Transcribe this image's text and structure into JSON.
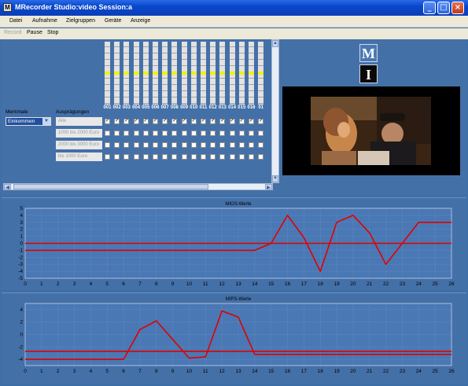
{
  "window": {
    "title": "MRecorder Studio:video Session:a",
    "app_icon": "M"
  },
  "menu": [
    "Datei",
    "Aufnahme",
    "Zielgruppen",
    "Geräte",
    "Anzeige"
  ],
  "toolbar": {
    "record": "Record",
    "pause": "Pause",
    "stop": "Stop"
  },
  "panel": {
    "merkmale_label": "Merkmale",
    "auspraegungen_label": "Ausprägungen",
    "merkmal_selected": "Einkommen",
    "auspraegungen": [
      "Alle",
      "1000 bis 2000 Euro",
      "2000 bis 3000 Euro",
      "bis 1000 Euro"
    ],
    "columns": [
      "001",
      "002",
      "003",
      "004",
      "005",
      "006",
      "007",
      "008",
      "009",
      "010",
      "011",
      "012",
      "013",
      "014",
      "015",
      "016",
      "01"
    ],
    "meter_level_fraction": 0.5,
    "colors": {
      "meter_level": "#f2f200",
      "panel_bg": "#4470a8"
    }
  },
  "logo": {
    "top": "M",
    "bottom": "I"
  },
  "chart_data": [
    {
      "type": "line",
      "title": "MIOS-Werte",
      "xlabel": "",
      "ylabel": "",
      "xlim": [
        0,
        26
      ],
      "ylim": [
        -5,
        5
      ],
      "xticks": [
        0,
        1,
        2,
        3,
        4,
        5,
        6,
        7,
        8,
        9,
        10,
        11,
        12,
        13,
        14,
        15,
        16,
        17,
        18,
        19,
        20,
        21,
        22,
        23,
        24,
        25,
        26
      ],
      "yticks": [
        5,
        4,
        3,
        2,
        1,
        0,
        -1,
        -2,
        -3,
        -4,
        -5
      ],
      "grid": true,
      "series": [
        {
          "color": "#e00000",
          "x": [
            0,
            26
          ],
          "y": [
            0,
            0
          ]
        },
        {
          "color": "#e00000",
          "x": [
            0,
            14,
            15,
            16,
            17,
            18,
            19,
            20,
            21,
            22,
            23,
            24,
            25,
            26
          ],
          "y": [
            -1,
            -1,
            0,
            4,
            0.8,
            -4,
            3,
            4,
            1.5,
            -3,
            0,
            3,
            3,
            3
          ]
        }
      ]
    },
    {
      "type": "line",
      "title": "MIPS-Werte",
      "xlabel": "",
      "ylabel": "",
      "xlim": [
        0,
        26
      ],
      "ylim": [
        -5,
        5
      ],
      "xticks": [
        0,
        1,
        2,
        3,
        4,
        5,
        6,
        7,
        8,
        9,
        10,
        11,
        12,
        13,
        14,
        15,
        16,
        17,
        18,
        19,
        20,
        21,
        22,
        23,
        24,
        25,
        26
      ],
      "yticks": [
        4,
        2,
        0,
        -2,
        -4
      ],
      "grid": true,
      "series": [
        {
          "color": "#e00000",
          "x": [
            0,
            26
          ],
          "y": [
            -2.7,
            -2.7
          ]
        },
        {
          "color": "#e00000",
          "x": [
            0,
            6,
            7,
            8,
            9,
            10,
            11,
            12,
            13,
            14,
            15,
            16,
            17,
            18,
            19,
            20,
            21,
            22,
            23,
            24,
            25,
            26
          ],
          "y": [
            -4,
            -4,
            0.8,
            2.2,
            -0.8,
            -3.8,
            -3.6,
            3.8,
            2.8,
            -3.2,
            -3.2,
            -3.2,
            -3.2,
            -3.2,
            -3.2,
            -3.2,
            -3.2,
            -3.2,
            -3.2,
            -3.2,
            -3.2,
            -3.2
          ]
        }
      ]
    }
  ]
}
